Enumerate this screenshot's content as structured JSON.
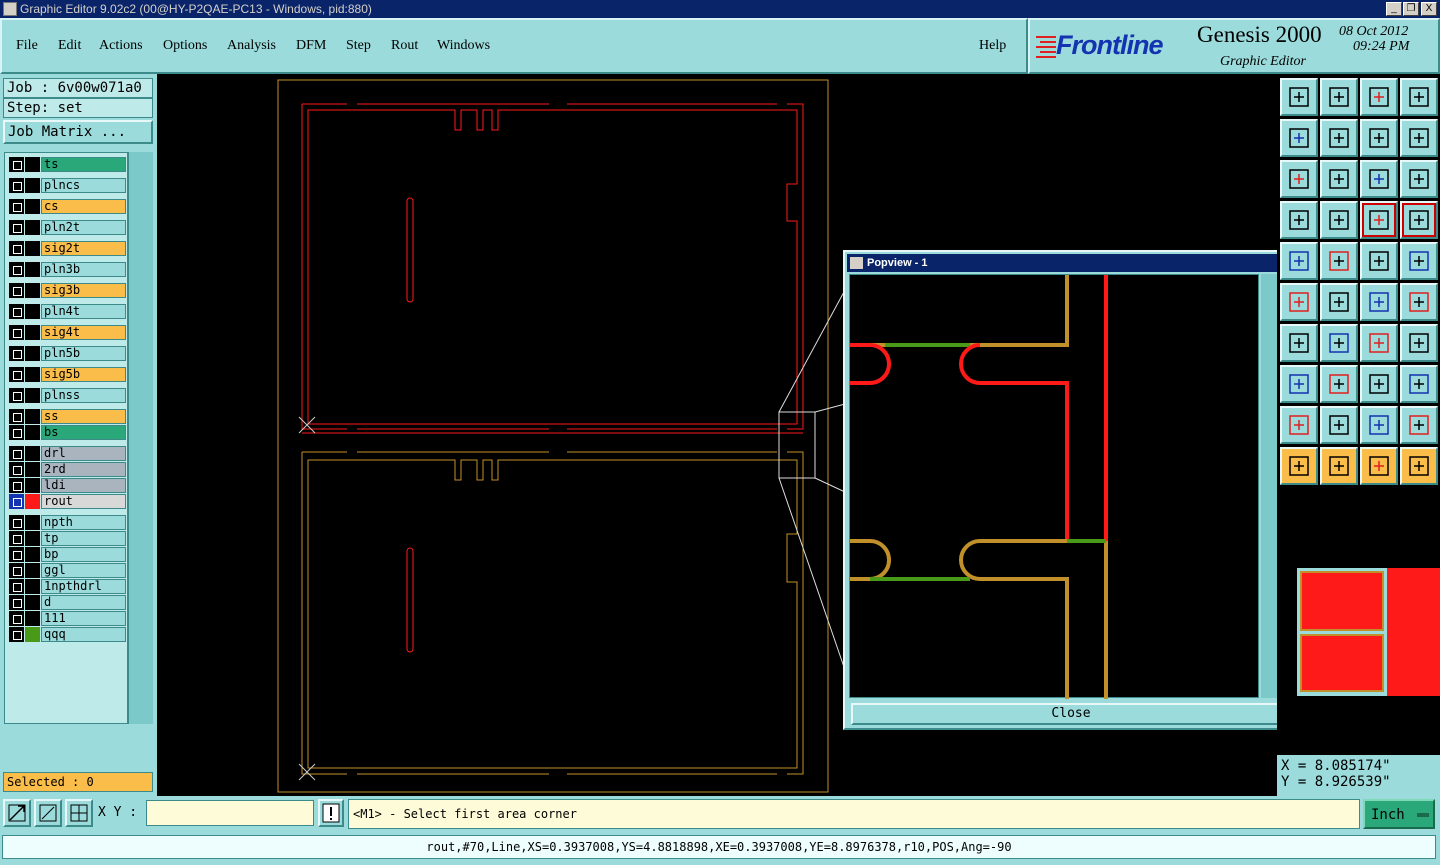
{
  "window": {
    "title": "Graphic Editor 9.02c2 (00@HY-P2QAE-PC13 - Windows, pid:880)",
    "buttons": [
      "_",
      "❐",
      "X"
    ]
  },
  "menu": {
    "items": [
      "File",
      "Edit",
      "Actions",
      "Options",
      "Analysis",
      "DFM",
      "Step",
      "Rout",
      "Windows"
    ],
    "help": "Help"
  },
  "brand": {
    "logo": "Frontline",
    "product": "Genesis 2000",
    "date": "08 Oct 2012",
    "time": "09:24 PM",
    "subtitle": "Graphic Editor"
  },
  "job": {
    "job_line": "Job : 6v00w071a0",
    "step_line": "Step: set",
    "matrix_button": "Job Matrix ..."
  },
  "layers": [
    {
      "name": "ts",
      "color": "#2aa87a"
    },
    {
      "name": "plncs",
      "color": "#9bdbdb"
    },
    {
      "name": "cs",
      "color": "#fbbd4a"
    },
    {
      "name": "pln2t",
      "color": "#9bdbdb"
    },
    {
      "name": "sig2t",
      "color": "#fbbd4a"
    },
    {
      "name": "pln3b",
      "color": "#9bdbdb"
    },
    {
      "name": "sig3b",
      "color": "#fbbd4a"
    },
    {
      "name": "pln4t",
      "color": "#9bdbdb"
    },
    {
      "name": "sig4t",
      "color": "#fbbd4a"
    },
    {
      "name": "pln5b",
      "color": "#9bdbdb"
    },
    {
      "name": "sig5b",
      "color": "#fbbd4a"
    },
    {
      "name": "plnss",
      "color": "#9bdbdb"
    },
    {
      "name": "ss",
      "color": "#fbbd4a"
    },
    {
      "name": "bs",
      "color": "#2aa87a"
    },
    {
      "name": "drl",
      "color": "#a9b4bf"
    },
    {
      "name": "2rd",
      "color": "#a9b4bf"
    },
    {
      "name": "ldi",
      "color": "#a9b4bf"
    },
    {
      "name": "rout",
      "color": "#d8d8d8"
    },
    {
      "name": "npth",
      "color": "#9bdbdb"
    },
    {
      "name": "tp",
      "color": "#9bdbdb"
    },
    {
      "name": "bp",
      "color": "#9bdbdb"
    },
    {
      "name": "ggl",
      "color": "#9bdbdb"
    },
    {
      "name": "1npthdrl",
      "color": "#9bdbdb"
    },
    {
      "name": "d",
      "color": "#9bdbdb"
    },
    {
      "name": "111",
      "color": "#9bdbdb"
    },
    {
      "name": "qqq",
      "color": "#9bdbdb"
    }
  ],
  "selected": "Selected : 0",
  "popview": {
    "title": "Popview - 1",
    "close_label": "Close"
  },
  "coords": {
    "x": "X = 8.085174\"",
    "y": "Y = 8.926539\""
  },
  "bottom": {
    "xy_label": "X Y :",
    "xy_value": "",
    "prompt": "<M1> - Select first area corner",
    "units": "Inch"
  },
  "status": "rout,#70,Line,XS=0.3937008,YS=4.8818898,XE=0.3937008,YE=8.8976378,r10,POS,Ang=-90",
  "colors": {
    "panel": "#9bdbdb",
    "orange": "#fbbd4a",
    "board_outline": "#c2902a",
    "rout": "#ff1a1a",
    "green": "#4a9a1a",
    "title_blue": "#0a246a"
  },
  "toolbar_icons": [
    "panel-top-icon",
    "panel-bottom-icon",
    "home-icon",
    "window-icon",
    "panel-left-icon",
    "panel-right-icon",
    "rotate-icon",
    "snake-icon",
    "fit-icon",
    "center-icon",
    "scale-1-2-icon",
    "help-icon",
    "tools-icon",
    "lock-icon",
    "net-icon",
    "net-red-icon",
    "draw-icon",
    "measure-icon",
    "ruler-icon",
    "circle-icon",
    "dot-icon",
    "cross-icon",
    "snap-icon",
    "node-icon",
    "line-icon",
    "edit-line-icon",
    "arc-icon",
    "pad-icon",
    "dot2-icon",
    "segment-icon",
    "snap-box-icon",
    "group-icon",
    "tri-icon",
    "tri2-icon",
    "tri3-icon",
    "tri4-icon",
    "select-icon",
    "arrow-box-icon",
    "arrow2-icon",
    "flow-icon"
  ]
}
